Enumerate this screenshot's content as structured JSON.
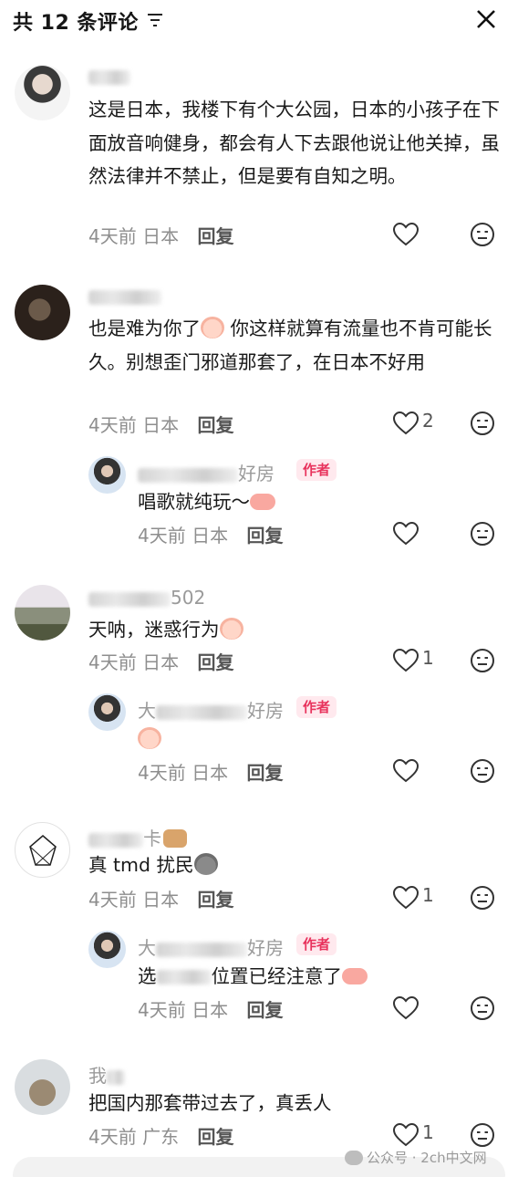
{
  "header": {
    "title": "共 12 条评论"
  },
  "comments": [
    {
      "username": "",
      "text": "这是日本，我楼下有个大公园，日本的小孩子在下面放音响健身，都会有人下去跟他说让他关掉，虽然法律并不禁止，但是要有自知之明。",
      "time": "4天前",
      "location": "日本",
      "reply": "回复",
      "likes": ""
    },
    {
      "username": "",
      "text_before": "也是难为你了",
      "text_after": " 你这样就算有流量也不肯可能长久。别想歪门邪道那套了，在日本不好用",
      "time": "4天前",
      "location": "日本",
      "reply": "回复",
      "likes": "2",
      "replies": [
        {
          "username_suffix": "好房",
          "tag": "作者",
          "text": "唱歌就纯玩～",
          "time": "4天前",
          "location": "日本",
          "reply": "回复",
          "likes": ""
        }
      ]
    },
    {
      "username_suffix": "502",
      "text": "天呐，迷惑行为",
      "time": "4天前",
      "location": "日本",
      "reply": "回复",
      "likes": "1",
      "replies": [
        {
          "username_prefix": "大",
          "username_suffix": "好房",
          "tag": "作者",
          "text": "",
          "time": "4天前",
          "location": "日本",
          "reply": "回复",
          "likes": ""
        }
      ]
    },
    {
      "username_suffix": "卡",
      "text": "真 tmd 扰民",
      "time": "4天前",
      "location": "日本",
      "reply": "回复",
      "likes": "1",
      "replies": [
        {
          "username_prefix": "大",
          "username_suffix": "好房",
          "tag": "作者",
          "text_prefix": "选",
          "text": "位置已经注意了",
          "time": "4天前",
          "location": "日本",
          "reply": "回复",
          "likes": ""
        }
      ]
    },
    {
      "username_prefix": "我",
      "text": "把国内那套带过去了，真丢人",
      "time": "4天前",
      "location": "广东",
      "reply": "回复",
      "likes": "1"
    }
  ],
  "watermark": "公众号 · 2ch中文网",
  "icons": [
    "filter-icon",
    "close-icon",
    "heart-icon",
    "dislike-icon"
  ],
  "colors": {
    "author_tag_bg": "#ffe9ee",
    "author_tag_text": "#e8335d",
    "meta": "#8e8e8e"
  }
}
